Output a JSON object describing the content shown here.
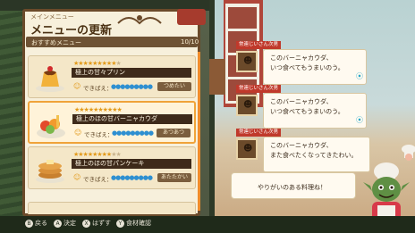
{
  "header": {
    "section_tag": "メインメニュー",
    "title": "メニューの更新"
  },
  "recommend": {
    "label": "おすすめメニュー",
    "count": "10/10"
  },
  "cards": [
    {
      "name": "極上の甘々プリン",
      "deki_label": "できばえ：",
      "tag": "つめたい",
      "stars_filled": 9,
      "stars_total": 10,
      "fish": "●●●●●●●●●",
      "food_icon": "pudding-icon"
    },
    {
      "name": "極上のほの甘バーニャカウダ",
      "deki_label": "できばえ：",
      "tag": "あつあつ",
      "stars_filled": 10,
      "stars_total": 10,
      "fish": "●●●●●●●●●",
      "food_icon": "salad-icon"
    },
    {
      "name": "極上のほの甘パンケーキ",
      "deki_label": "できばえ：",
      "tag": "あたたかい",
      "stars_filled": 8,
      "stars_total": 10,
      "fish": "●●●●●●●●●",
      "food_icon": "pancake-icon"
    }
  ],
  "messages": [
    {
      "sender": "常連じいさん次男",
      "lines": [
        "このバーニャカウダ、",
        "いつ食べてもうまいのう。"
      ]
    },
    {
      "sender": "常連じいさん次男",
      "lines": [
        "このバーニャカウダ、",
        "いつ食べてもうまいのう。"
      ]
    },
    {
      "sender": "常連じいさん次男",
      "lines": [
        "このバーニャカウダ、",
        "また食べたくなってきたわい。"
      ]
    }
  ],
  "chef_message": "やりがいのある料理ね！",
  "hints": [
    {
      "key": "B",
      "label": "戻る"
    },
    {
      "key": "A",
      "label": "決定"
    },
    {
      "key": "X",
      "label": "はずす"
    },
    {
      "key": "Y",
      "label": "食材確認"
    }
  ],
  "colors": {
    "accent": "#f0a33a",
    "star": "#e29a1b",
    "sender_bg": "#c0392b",
    "fish": "#2e8fd1"
  }
}
